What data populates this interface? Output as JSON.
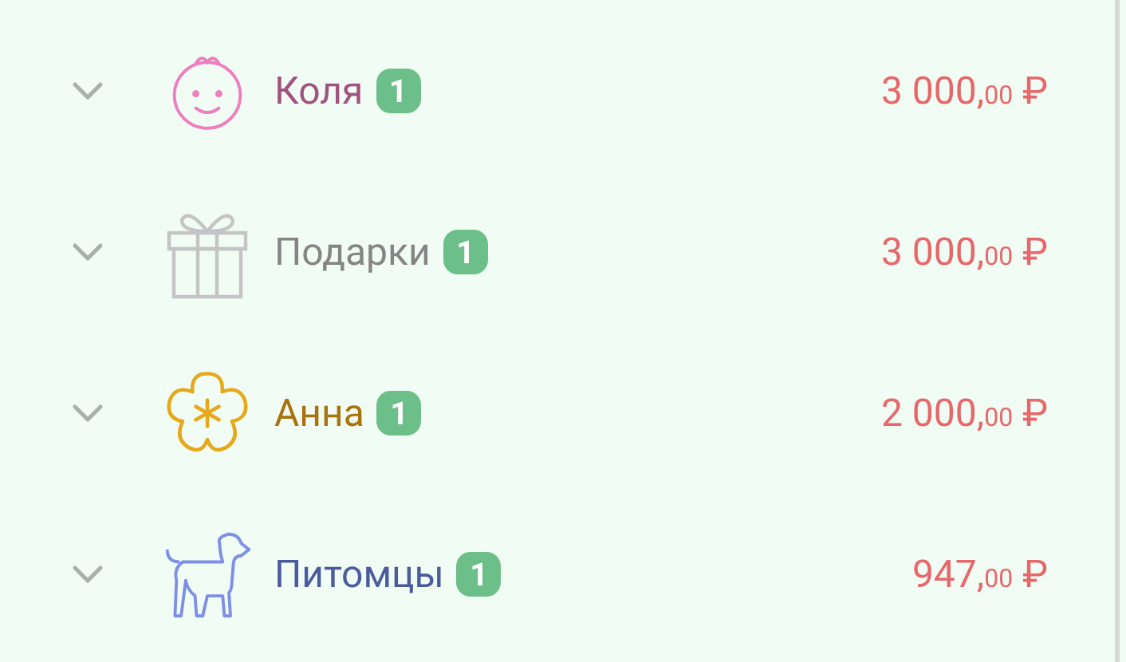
{
  "categories": [
    {
      "kind": "baby",
      "name": "Коля",
      "count": "1",
      "amount": "3 000,",
      "cents": "00",
      "currency": "₽",
      "color": "#a2527e"
    },
    {
      "kind": "gift",
      "name": "Подарки",
      "count": "1",
      "amount": "3 000,",
      "cents": "00",
      "currency": "₽",
      "color": "#858585"
    },
    {
      "kind": "flower",
      "name": "Анна",
      "count": "1",
      "amount": "2 000,",
      "cents": "00",
      "currency": "₽",
      "color": "#a8720c"
    },
    {
      "kind": "dog",
      "name": "Питомцы",
      "count": "1",
      "amount": "947,",
      "cents": "00",
      "currency": "₽",
      "color": "#4b5b9e"
    }
  ]
}
